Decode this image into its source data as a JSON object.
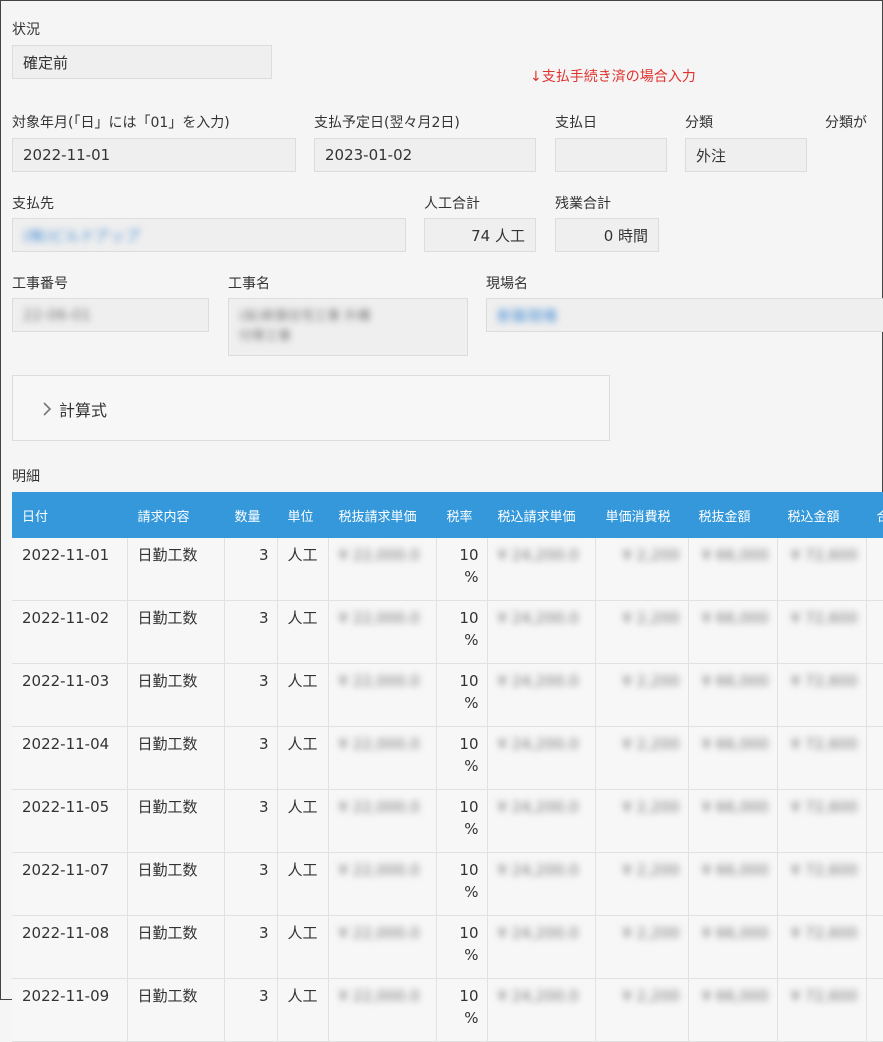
{
  "status": {
    "label": "状況",
    "value": "確定前"
  },
  "note": "↓支払手続き済の場合入力",
  "target_month": {
    "label": "対象年月(「日」には「01」を入力)",
    "value": "2022-11-01"
  },
  "payment_due": {
    "label": "支払予定日(翌々月2日)",
    "value": "2023-01-02"
  },
  "payment_date": {
    "label": "支払日",
    "value": ""
  },
  "category": {
    "label": "分類",
    "value": "外注"
  },
  "category_extra": {
    "label": "分類が"
  },
  "payee": {
    "label": "支払先",
    "value": "(株)ビルドアップ"
  },
  "labor_total": {
    "label": "人工合計",
    "value": "74 人工"
  },
  "overtime_total": {
    "label": "残業合計",
    "value": "0 時間"
  },
  "project_no": {
    "label": "工事番号",
    "value": "22-06-01"
  },
  "project_name": {
    "label": "工事名",
    "line1": "(仮)新築住宅工事 外構",
    "line2": "付帯工事"
  },
  "site_name": {
    "label": "現場名",
    "value": "新築現場"
  },
  "formula": {
    "label": "計算式"
  },
  "detail": {
    "label": "明細",
    "headers": [
      "日付",
      "請求内容",
      "数量",
      "単位",
      "税抜請求単価",
      "税率",
      "税込請求単価",
      "単価消費税",
      "税抜金額",
      "税込金額",
      "合"
    ],
    "rows": [
      {
        "date": "2022-11-01",
        "item": "日勤工数",
        "qty": "3",
        "unit": "人工",
        "rate_num": "10",
        "rate_pct": "%",
        "price_ex": "¥ 22,000.0",
        "price_in": "¥ 24,200.0",
        "tax": "¥ 2,200",
        "amount_ex": "¥ 66,000",
        "amount_in": "¥ 72,600"
      },
      {
        "date": "2022-11-02",
        "item": "日勤工数",
        "qty": "3",
        "unit": "人工",
        "rate_num": "10",
        "rate_pct": "%",
        "price_ex": "¥ 22,000.0",
        "price_in": "¥ 24,200.0",
        "tax": "¥ 2,200",
        "amount_ex": "¥ 66,000",
        "amount_in": "¥ 72,600"
      },
      {
        "date": "2022-11-03",
        "item": "日勤工数",
        "qty": "3",
        "unit": "人工",
        "rate_num": "10",
        "rate_pct": "%",
        "price_ex": "¥ 22,000.0",
        "price_in": "¥ 24,200.0",
        "tax": "¥ 2,200",
        "amount_ex": "¥ 66,000",
        "amount_in": "¥ 72,600"
      },
      {
        "date": "2022-11-04",
        "item": "日勤工数",
        "qty": "3",
        "unit": "人工",
        "rate_num": "10",
        "rate_pct": "%",
        "price_ex": "¥ 22,000.0",
        "price_in": "¥ 24,200.0",
        "tax": "¥ 2,200",
        "amount_ex": "¥ 66,000",
        "amount_in": "¥ 72,600"
      },
      {
        "date": "2022-11-05",
        "item": "日勤工数",
        "qty": "3",
        "unit": "人工",
        "rate_num": "10",
        "rate_pct": "%",
        "price_ex": "¥ 22,000.0",
        "price_in": "¥ 24,200.0",
        "tax": "¥ 2,200",
        "amount_ex": "¥ 66,000",
        "amount_in": "¥ 72,600"
      },
      {
        "date": "2022-11-07",
        "item": "日勤工数",
        "qty": "3",
        "unit": "人工",
        "rate_num": "10",
        "rate_pct": "%",
        "price_ex": "¥ 22,000.0",
        "price_in": "¥ 24,200.0",
        "tax": "¥ 2,200",
        "amount_ex": "¥ 66,000",
        "amount_in": "¥ 72,600"
      },
      {
        "date": "2022-11-08",
        "item": "日勤工数",
        "qty": "3",
        "unit": "人工",
        "rate_num": "10",
        "rate_pct": "%",
        "price_ex": "¥ 22,000.0",
        "price_in": "¥ 24,200.0",
        "tax": "¥ 2,200",
        "amount_ex": "¥ 66,000",
        "amount_in": "¥ 72,600"
      },
      {
        "date": "2022-11-09",
        "item": "日勤工数",
        "qty": "3",
        "unit": "人工",
        "rate_num": "10",
        "rate_pct": "%",
        "price_ex": "¥ 22,000.0",
        "price_in": "¥ 24,200.0",
        "tax": "¥ 2,200",
        "amount_ex": "¥ 66,000",
        "amount_in": "¥ 72,600"
      }
    ]
  }
}
